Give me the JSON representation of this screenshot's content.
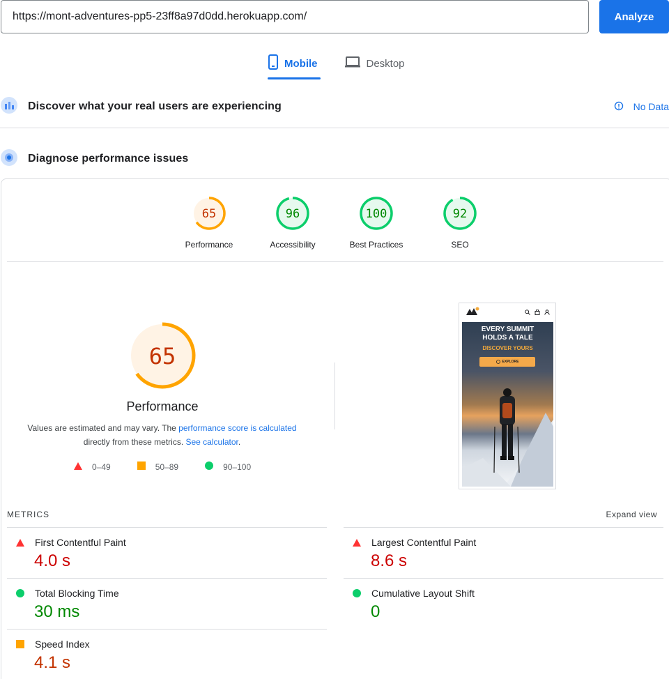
{
  "search": {
    "url": "https://mont-adventures-pp5-23ff8a97d0dd.herokuapp.com/",
    "analyze_label": "Analyze"
  },
  "tabs": [
    {
      "label": "Mobile",
      "active": true
    },
    {
      "label": "Desktop",
      "active": false
    }
  ],
  "crux": {
    "title": "Discover what your real users are experiencing",
    "no_data_label": "No Data"
  },
  "diagnose": {
    "title": "Diagnose performance issues"
  },
  "categories": [
    {
      "label": "Performance",
      "score": "65",
      "color": "#fa8c16",
      "fraction": 0.65
    },
    {
      "label": "Accessibility",
      "score": "96",
      "color": "#0cce6b",
      "fraction": 0.96
    },
    {
      "label": "Best Practices",
      "score": "100",
      "color": "#0cce6b",
      "fraction": 1.0
    },
    {
      "label": "SEO",
      "score": "92",
      "color": "#0cce6b",
      "fraction": 0.92
    }
  ],
  "performance": {
    "score": "65",
    "fraction": 0.65,
    "title": "Performance",
    "desc_pre": "Values are estimated and may vary. The ",
    "desc_link1": "performance score is calculated",
    "desc_mid": " directly from these metrics. ",
    "desc_link2": "See calculator",
    "desc_post": ".",
    "legend": [
      "0–49",
      "50–89",
      "90–100"
    ]
  },
  "screenshot": {
    "hero_line1": "EVERY SUMMIT",
    "hero_line2": "HOLDS A TALE",
    "hero_sub": "DISCOVER YOURS",
    "hero_button": "EXPLORE"
  },
  "metrics": {
    "heading": "METRICS",
    "expand_label": "Expand view",
    "items": [
      {
        "name": "First Contentful Paint",
        "value": "4.0 s",
        "status": "fail"
      },
      {
        "name": "Largest Contentful Paint",
        "value": "8.6 s",
        "status": "fail"
      },
      {
        "name": "Total Blocking Time",
        "value": "30 ms",
        "status": "pass"
      },
      {
        "name": "Cumulative Layout Shift",
        "value": "0",
        "status": "pass"
      },
      {
        "name": "Speed Index",
        "value": "4.1 s",
        "status": "average"
      }
    ]
  },
  "colors": {
    "accent": "#1a73e8",
    "fail": "#ff3333",
    "average": "#ffa400",
    "pass": "#0cce6b"
  },
  "icons": {
    "tab_mobile": "phone-icon",
    "tab_desktop": "laptop-icon",
    "crux": "users-chart-icon",
    "diagnose": "lighthouse-icon",
    "info": "info-icon"
  }
}
